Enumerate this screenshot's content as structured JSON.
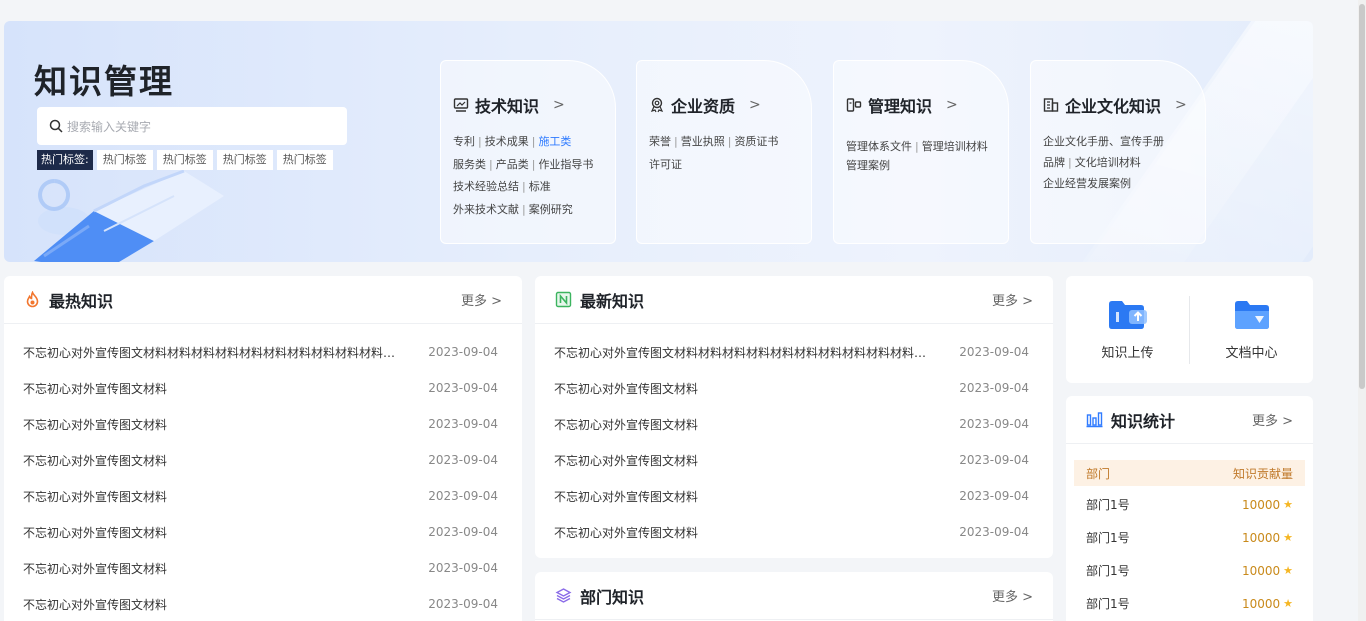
{
  "banner": {
    "title": "知识管理",
    "search_placeholder": "搜索输入关键字",
    "hot_label": "热门标签:",
    "hot_tags": [
      "热门标签",
      "热门标签",
      "热门标签",
      "热门标签"
    ]
  },
  "categories": [
    {
      "title": "技术知识",
      "icon": "monitor-icon",
      "lines": [
        [
          "专利",
          "技术成果",
          "施工类"
        ],
        [
          "服务类",
          "产品类",
          "作业指导书"
        ],
        [
          "技术经验总结",
          "标准"
        ],
        [
          "外来技术文献",
          "案例研究"
        ]
      ],
      "highlight": "施工类"
    },
    {
      "title": "企业资质",
      "icon": "award-icon",
      "lines": [
        [
          "荣誉",
          "营业执照",
          "资质证书"
        ],
        [
          "许可证"
        ]
      ]
    },
    {
      "title": "管理知识",
      "icon": "doc-flow-icon",
      "lines": [
        [
          "管理体系文件",
          "管理培训材料"
        ],
        [
          "管理案例"
        ]
      ]
    },
    {
      "title": "企业文化知识",
      "icon": "building-icon",
      "lines": [
        [
          "企业文化手册、宣传手册"
        ],
        [
          "品牌",
          "文化培训材料"
        ],
        [
          "企业经营发展案例"
        ]
      ]
    }
  ],
  "hot": {
    "title": "最热知识",
    "more": "更多 >",
    "rows": [
      {
        "text": "不忘初心对外宣传图文材料材料材料材料材料材料材料材料材料材料材料材料...",
        "date": "2023-09-04"
      },
      {
        "text": "不忘初心对外宣传图文材料",
        "date": "2023-09-04"
      },
      {
        "text": "不忘初心对外宣传图文材料",
        "date": "2023-09-04"
      },
      {
        "text": "不忘初心对外宣传图文材料",
        "date": "2023-09-04"
      },
      {
        "text": "不忘初心对外宣传图文材料",
        "date": "2023-09-04"
      },
      {
        "text": "不忘初心对外宣传图文材料",
        "date": "2023-09-04"
      },
      {
        "text": "不忘初心对外宣传图文材料",
        "date": "2023-09-04"
      },
      {
        "text": "不忘初心对外宣传图文材料",
        "date": "2023-09-04"
      }
    ]
  },
  "latest": {
    "title": "最新知识",
    "more": "更多 >",
    "rows": [
      {
        "text": "不忘初心对外宣传图文材料材料材料材料材料材料材料材料材料材料材料材料...",
        "date": "2023-09-04"
      },
      {
        "text": "不忘初心对外宣传图文材料",
        "date": "2023-09-04"
      },
      {
        "text": "不忘初心对外宣传图文材料",
        "date": "2023-09-04"
      },
      {
        "text": "不忘初心对外宣传图文材料",
        "date": "2023-09-04"
      },
      {
        "text": "不忘初心对外宣传图文材料",
        "date": "2023-09-04"
      },
      {
        "text": "不忘初心对外宣传图文材料",
        "date": "2023-09-04"
      }
    ]
  },
  "dept": {
    "title": "部门知识",
    "more": "更多 >"
  },
  "quick": {
    "upload": "知识上传",
    "docs": "文档中心"
  },
  "stats": {
    "title": "知识统计",
    "more": "更多 >",
    "col_dept": "部门",
    "col_value": "知识贡献量",
    "rows": [
      {
        "dept": "部门1号",
        "value": "10000"
      },
      {
        "dept": "部门1号",
        "value": "10000"
      },
      {
        "dept": "部门1号",
        "value": "10000"
      },
      {
        "dept": "部门1号",
        "value": "10000"
      }
    ]
  },
  "colors": {
    "accent": "#2f7bff",
    "hot": "#f2762e",
    "gold": "#f5b623"
  }
}
